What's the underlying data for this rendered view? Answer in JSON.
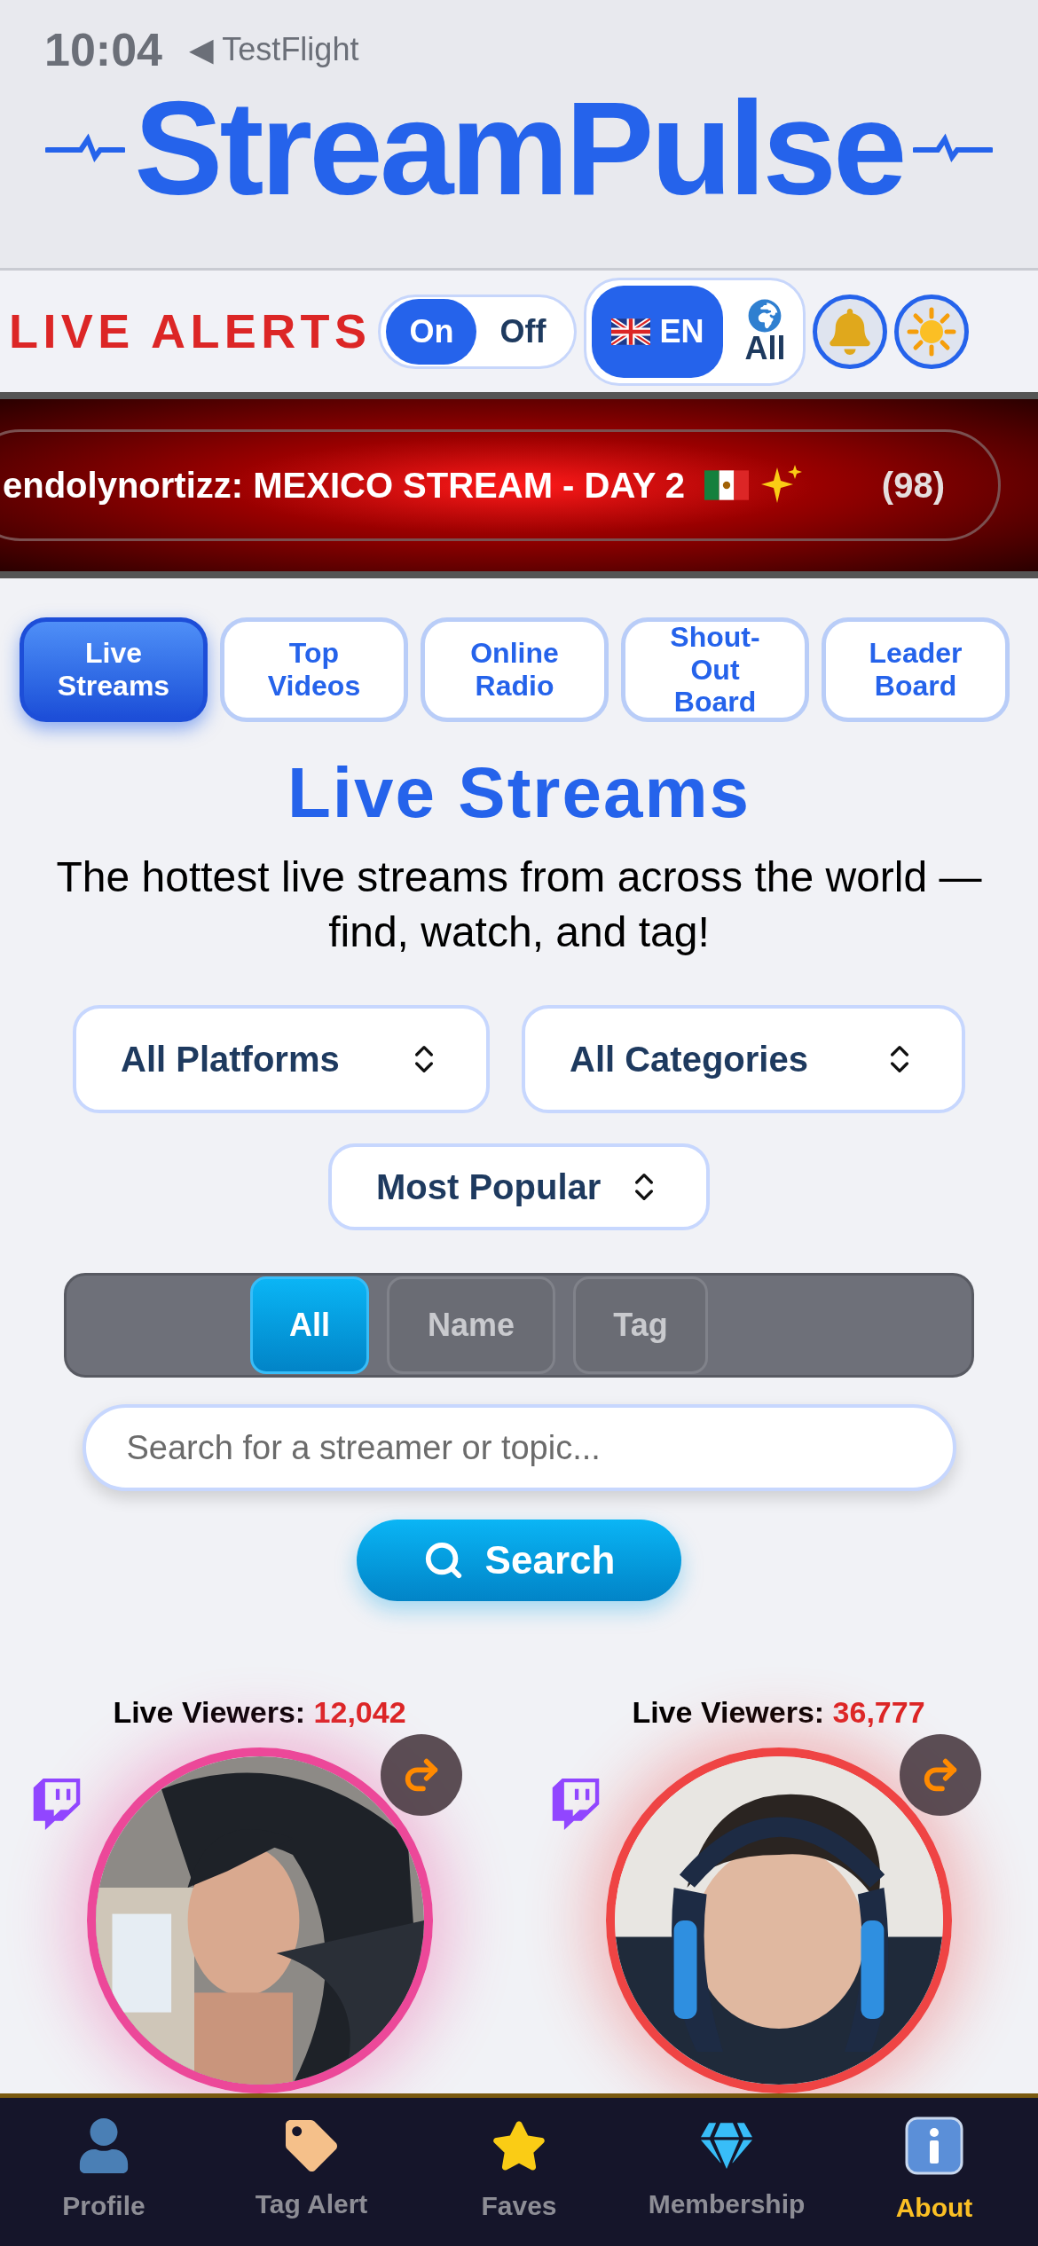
{
  "status_bar": {
    "time": "10:04",
    "back": "◀ TestFlight"
  },
  "logo": "StreamPulse",
  "alerts": {
    "label": "LIVE ALERTS",
    "options": [
      {
        "label": "On",
        "selected": true
      },
      {
        "label": "Off",
        "selected": false
      }
    ]
  },
  "language": [
    {
      "label": "EN",
      "kind": "flag",
      "selected": true
    },
    {
      "label": "All",
      "kind": "globe",
      "selected": false
    }
  ],
  "ticker": {
    "text": "endolynortizz: MEXICO STREAM - DAY 2",
    "count": "(98)"
  },
  "tabs": [
    {
      "label": "Live Streams",
      "selected": true
    },
    {
      "label": "Top Videos",
      "selected": false
    },
    {
      "label": "Online Radio",
      "selected": false
    },
    {
      "label": "Shout-Out Board",
      "selected": false
    },
    {
      "label": "Leader Board",
      "selected": false
    }
  ],
  "heading": "Live Streams",
  "subtitle": "The hottest live streams from across the world — find, watch, and tag!",
  "filters": [
    {
      "value": "All Platforms"
    },
    {
      "value": "All Categories"
    },
    {
      "value": "Most Popular"
    }
  ],
  "search_modes": [
    {
      "label": "All",
      "selected": true
    },
    {
      "label": "Name",
      "selected": false
    },
    {
      "label": "Tag",
      "selected": false
    }
  ],
  "search": {
    "placeholder": "Search for a streamer or topic...",
    "button": "Search"
  },
  "streams": [
    {
      "label": "Live Viewers:",
      "viewers": "12,042",
      "color": "#ec4899",
      "kind": "picture"
    },
    {
      "label": "Live Viewers:",
      "viewers": "36,777",
      "color": "#ef4444",
      "kind": "picture"
    }
  ],
  "nav": [
    {
      "label": "Profile",
      "kind": "person",
      "selected": false
    },
    {
      "label": "Tag Alert",
      "kind": "tag",
      "selected": false
    },
    {
      "label": "Faves",
      "kind": "star",
      "selected": false
    },
    {
      "label": "Membership",
      "kind": "gem",
      "selected": false
    },
    {
      "label": "About",
      "kind": "info",
      "selected": true
    }
  ]
}
